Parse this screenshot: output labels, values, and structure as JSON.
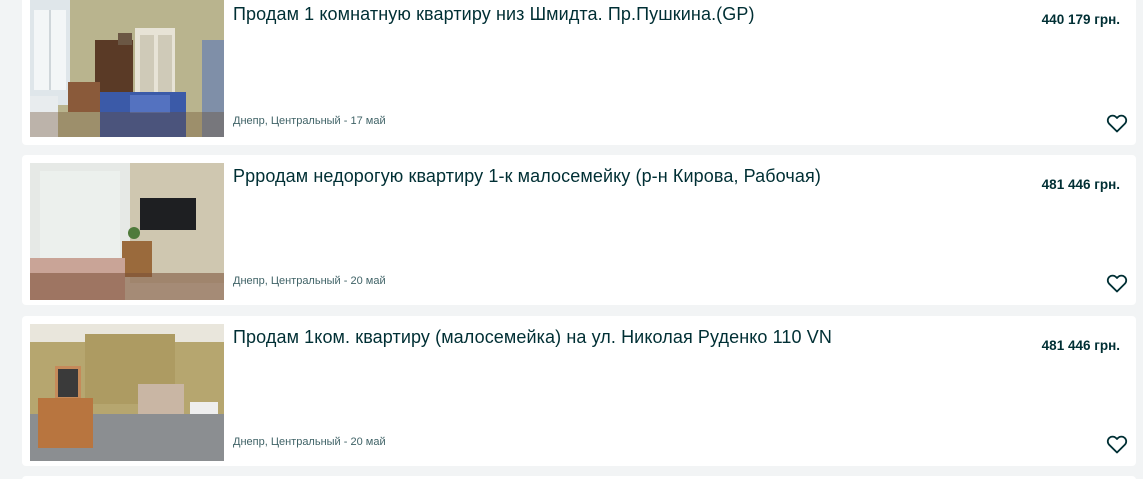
{
  "listings": [
    {
      "title": "Продам 1 комнатную квартиру низ Шмидта. Пр.Пушкина.(GP)",
      "price": "440 179 грн.",
      "location_date": "Днепр, Центральный - 17 май",
      "image": "room-photo-1",
      "favorite_icon": "heart-outline-icon"
    },
    {
      "title": "Ррродам недорогую квартиру 1-к малосемейку (р-н Кирова, Рабочая)",
      "price": "481 446 грн.",
      "location_date": "Днепр, Центральный - 20 май",
      "image": "room-photo-2",
      "favorite_icon": "heart-outline-icon"
    },
    {
      "title": "Продам 1ком. квартиру (малосемейка) на ул. Николая Руденко 110 VN",
      "price": "481 446 грн.",
      "location_date": "Днепр, Центральный - 20 май",
      "image": "room-photo-3",
      "favorite_icon": "heart-outline-icon"
    }
  ],
  "colors": {
    "page_bg": "#f2f4f5",
    "card_bg": "#ffffff",
    "text": "#002f34",
    "meta_text": "#406367"
  }
}
